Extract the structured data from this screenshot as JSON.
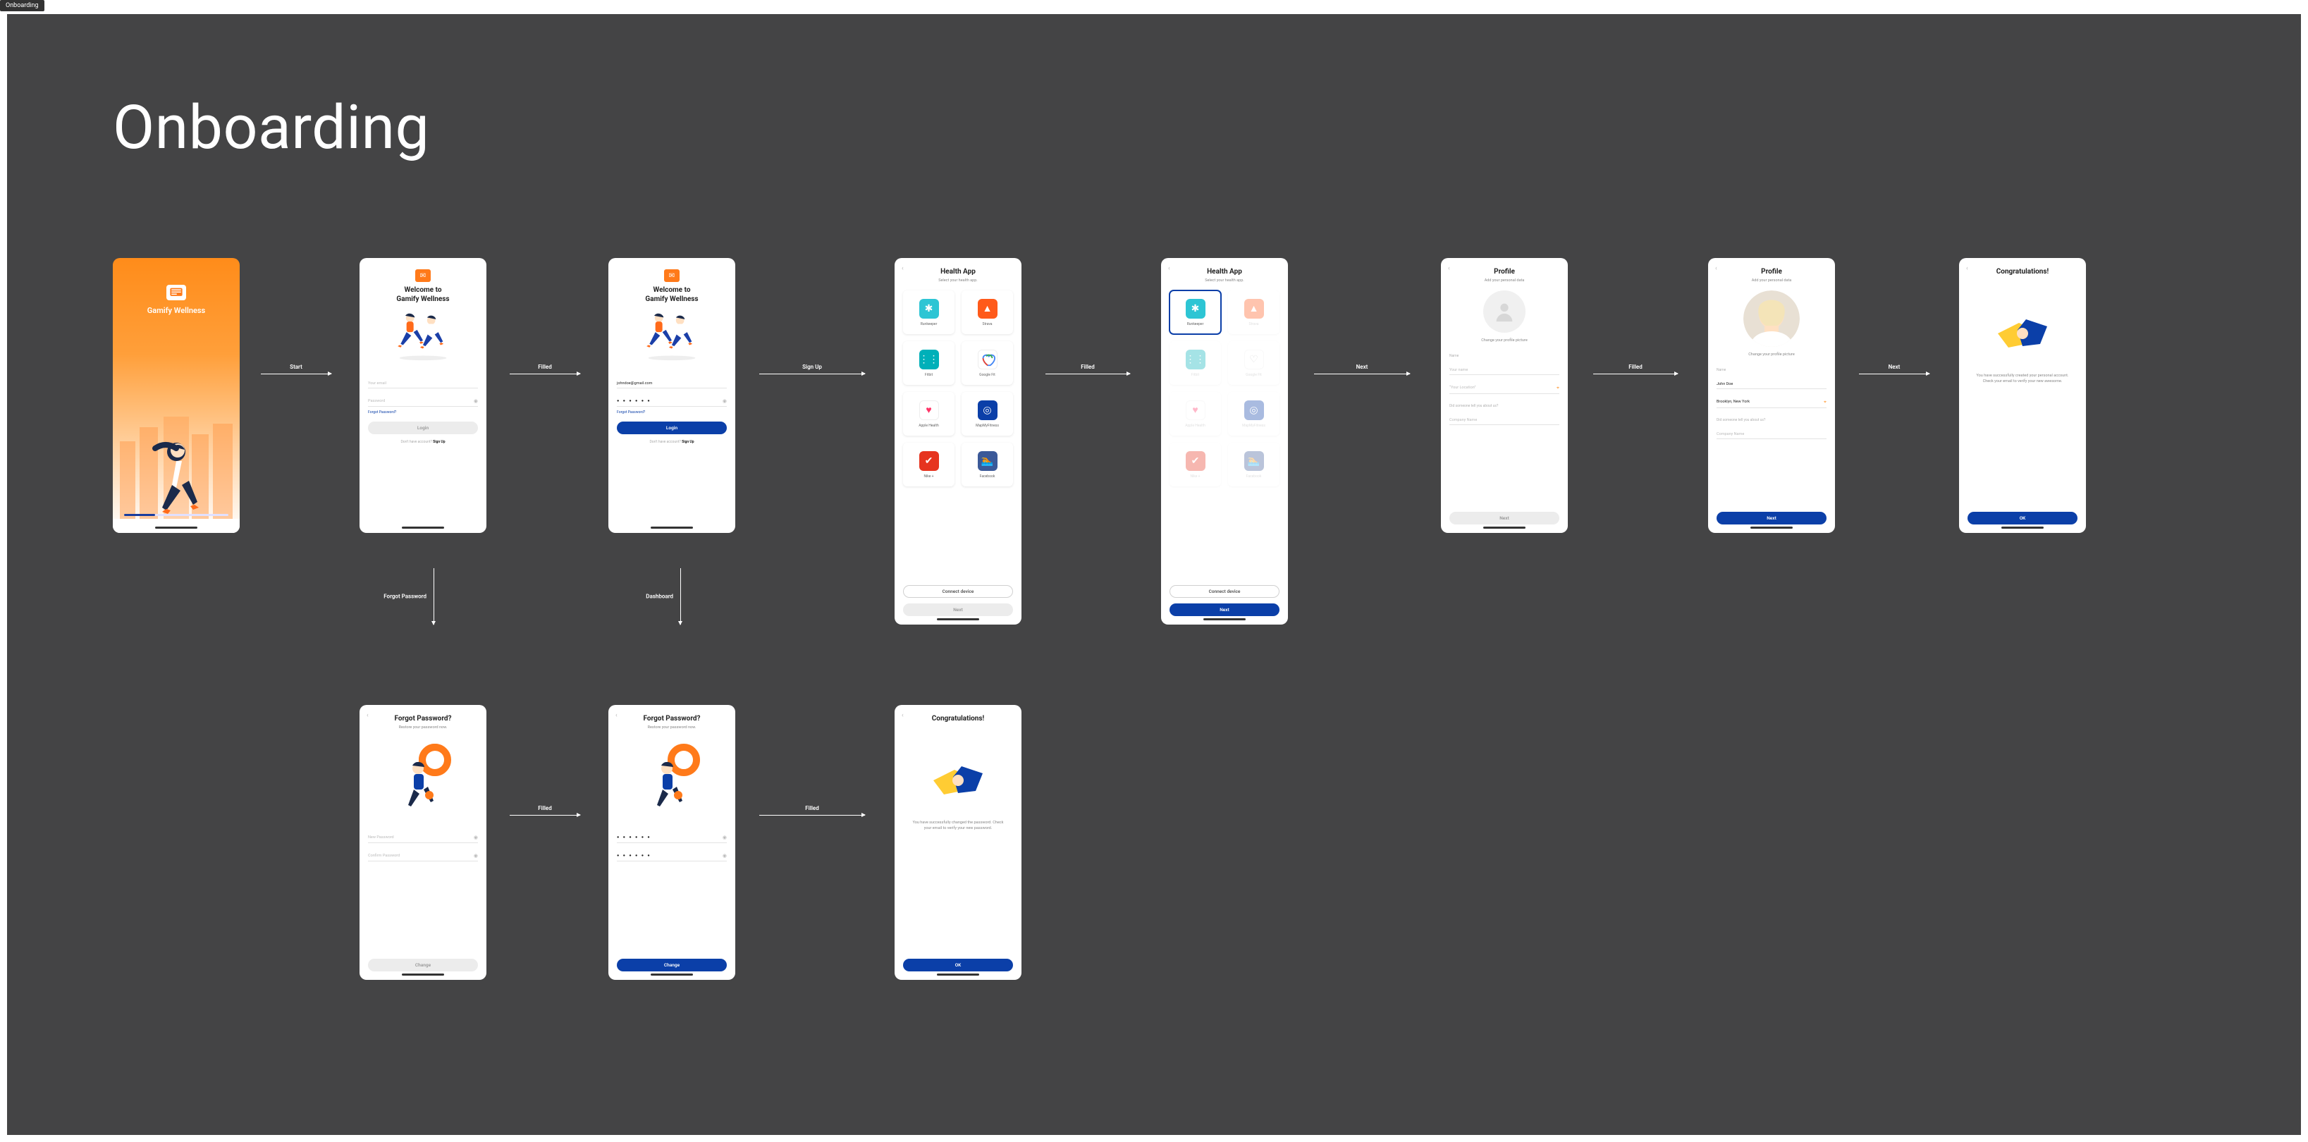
{
  "tab": "Onboarding",
  "title": "Onboarding",
  "arrows": {
    "start": "Start",
    "filled": "Filled",
    "signup": "Sign Up",
    "next": "Next",
    "forgot": "Forgot Password",
    "dashboard": "Dashboard"
  },
  "splash": {
    "app_name": "Gamify Wellness"
  },
  "login": {
    "welcome_line1": "Welcome to",
    "welcome_line2": "Gamify Wellness",
    "email_ph": "Your email",
    "pass_ph": "Password",
    "forgot": "Forgot Password?",
    "login_btn": "Login",
    "no_acc": "Don't have account?",
    "signup": "Sign Up"
  },
  "login_filled": {
    "email": "johndoe@gmail.com",
    "pass": "● ● ● ● ● ●",
    "forgot": "Forgot Password?",
    "login_btn": "Login",
    "no_acc": "Don't have account?",
    "signup": "Sign Up"
  },
  "health": {
    "title": "Health App",
    "sub": "Select your health app.",
    "apps": [
      {
        "name": "Runkeeper",
        "color": "#2dc5d4"
      },
      {
        "name": "Strava",
        "color": "#ff5a1a"
      },
      {
        "name": "Fitbit",
        "color": "#00b0b9"
      },
      {
        "name": "Google Fit",
        "color": "#ffffff"
      },
      {
        "name": "Apple Health",
        "color": "#ffffff"
      },
      {
        "name": "MapMyFitness",
        "color": "#0b3fa8"
      },
      {
        "name": "Nike +",
        "color": "#e6341f"
      },
      {
        "name": "Facebook",
        "color": "#3b5998"
      }
    ],
    "connect": "Connect device",
    "next": "Next"
  },
  "profile": {
    "title": "Profile",
    "sub": "Add your personal data",
    "change_pic": "Change your profile picture",
    "name_lbl": "Name",
    "name_ph": "Your name",
    "name_val": "John Doe",
    "loc_ph": "“Your Location”",
    "loc_val": "Brooklyn, New York",
    "company_lbl": "Did someone tell you about us?",
    "company_ph": "Company Name",
    "next": "Next"
  },
  "congrats": {
    "title": "Congratulations!",
    "msg_profile": "You have successfully created your personal account. Check your email to verify your new awesome.",
    "msg_pwd": "You have successfully changed the password. Check your email to verify your new password.",
    "ok": "OK"
  },
  "forgot": {
    "title": "Forgot Password?",
    "sub": "Restore your password now.",
    "newpwd_ph": "New Password",
    "confirm_ph": "Confirm Password",
    "pass": "● ● ● ● ● ●",
    "change": "Change"
  }
}
